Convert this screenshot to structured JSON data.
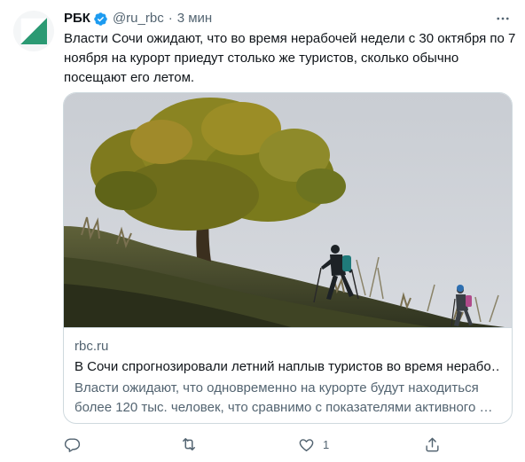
{
  "tweet": {
    "author_name": "РБК",
    "handle": "@ru_rbc",
    "separator": "·",
    "time": "3 мин",
    "text": "Власти Сочи ожидают, что во время нерабочей недели с 30 октября по 7 ноября на курорт приедут столько же туристов, сколько обычно посещают его летом."
  },
  "card": {
    "domain": "rbc.ru",
    "title": "В Сочи спрогнозировали летний наплыв туристов во время нерабо…",
    "description": "Власти ожидают, что одновременно на курорте будут находиться более 120 тыс. человек, что сравнимо с показателями активного …"
  },
  "actions": {
    "reply_count": "",
    "retweet_count": "",
    "like_count": "1",
    "share_count": ""
  },
  "colors": {
    "verified": "#1d9bf0",
    "secondary_text": "#536471",
    "border": "#cfd9de",
    "logo_green": "#2b9a73"
  },
  "icons": [
    "verified-badge-icon",
    "more-icon",
    "reply-icon",
    "retweet-icon",
    "like-icon",
    "share-icon"
  ]
}
